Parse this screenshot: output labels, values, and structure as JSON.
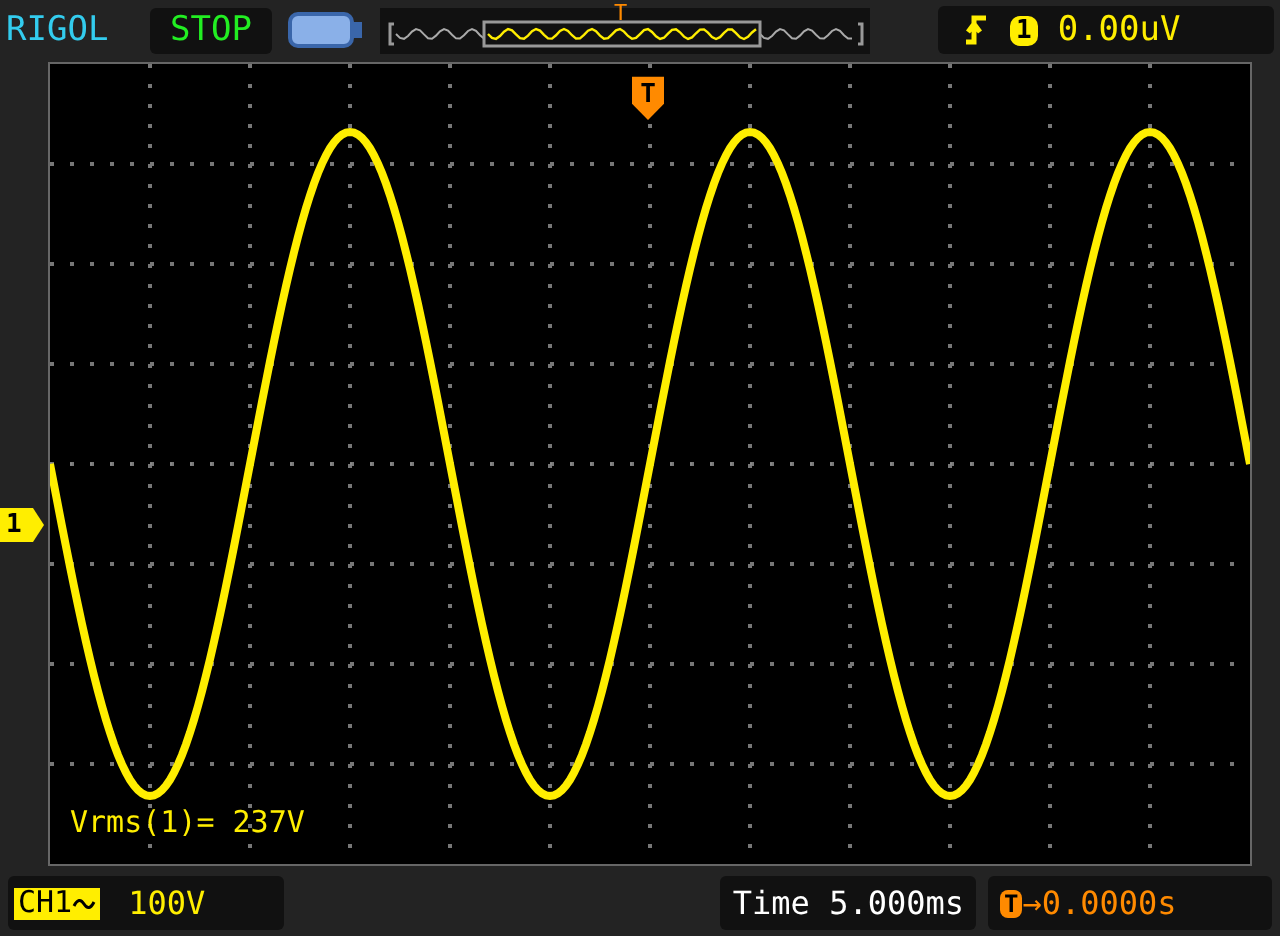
{
  "top_bar": {
    "brand": "RIGOL",
    "run_state": "STOP",
    "memory_trigger_marker": "T",
    "trigger": {
      "channel": "1",
      "level": "0.00uV"
    }
  },
  "screen": {
    "trigger_marker": "T",
    "channel_marker": "1",
    "measurement": "Vrms(1)= 237V"
  },
  "bottom_bar": {
    "channel": "CH1",
    "scale": "100V",
    "timebase": "Time 5.000ms",
    "trigger_position_marker": "T",
    "trigger_offset": "→0.0000s"
  }
}
